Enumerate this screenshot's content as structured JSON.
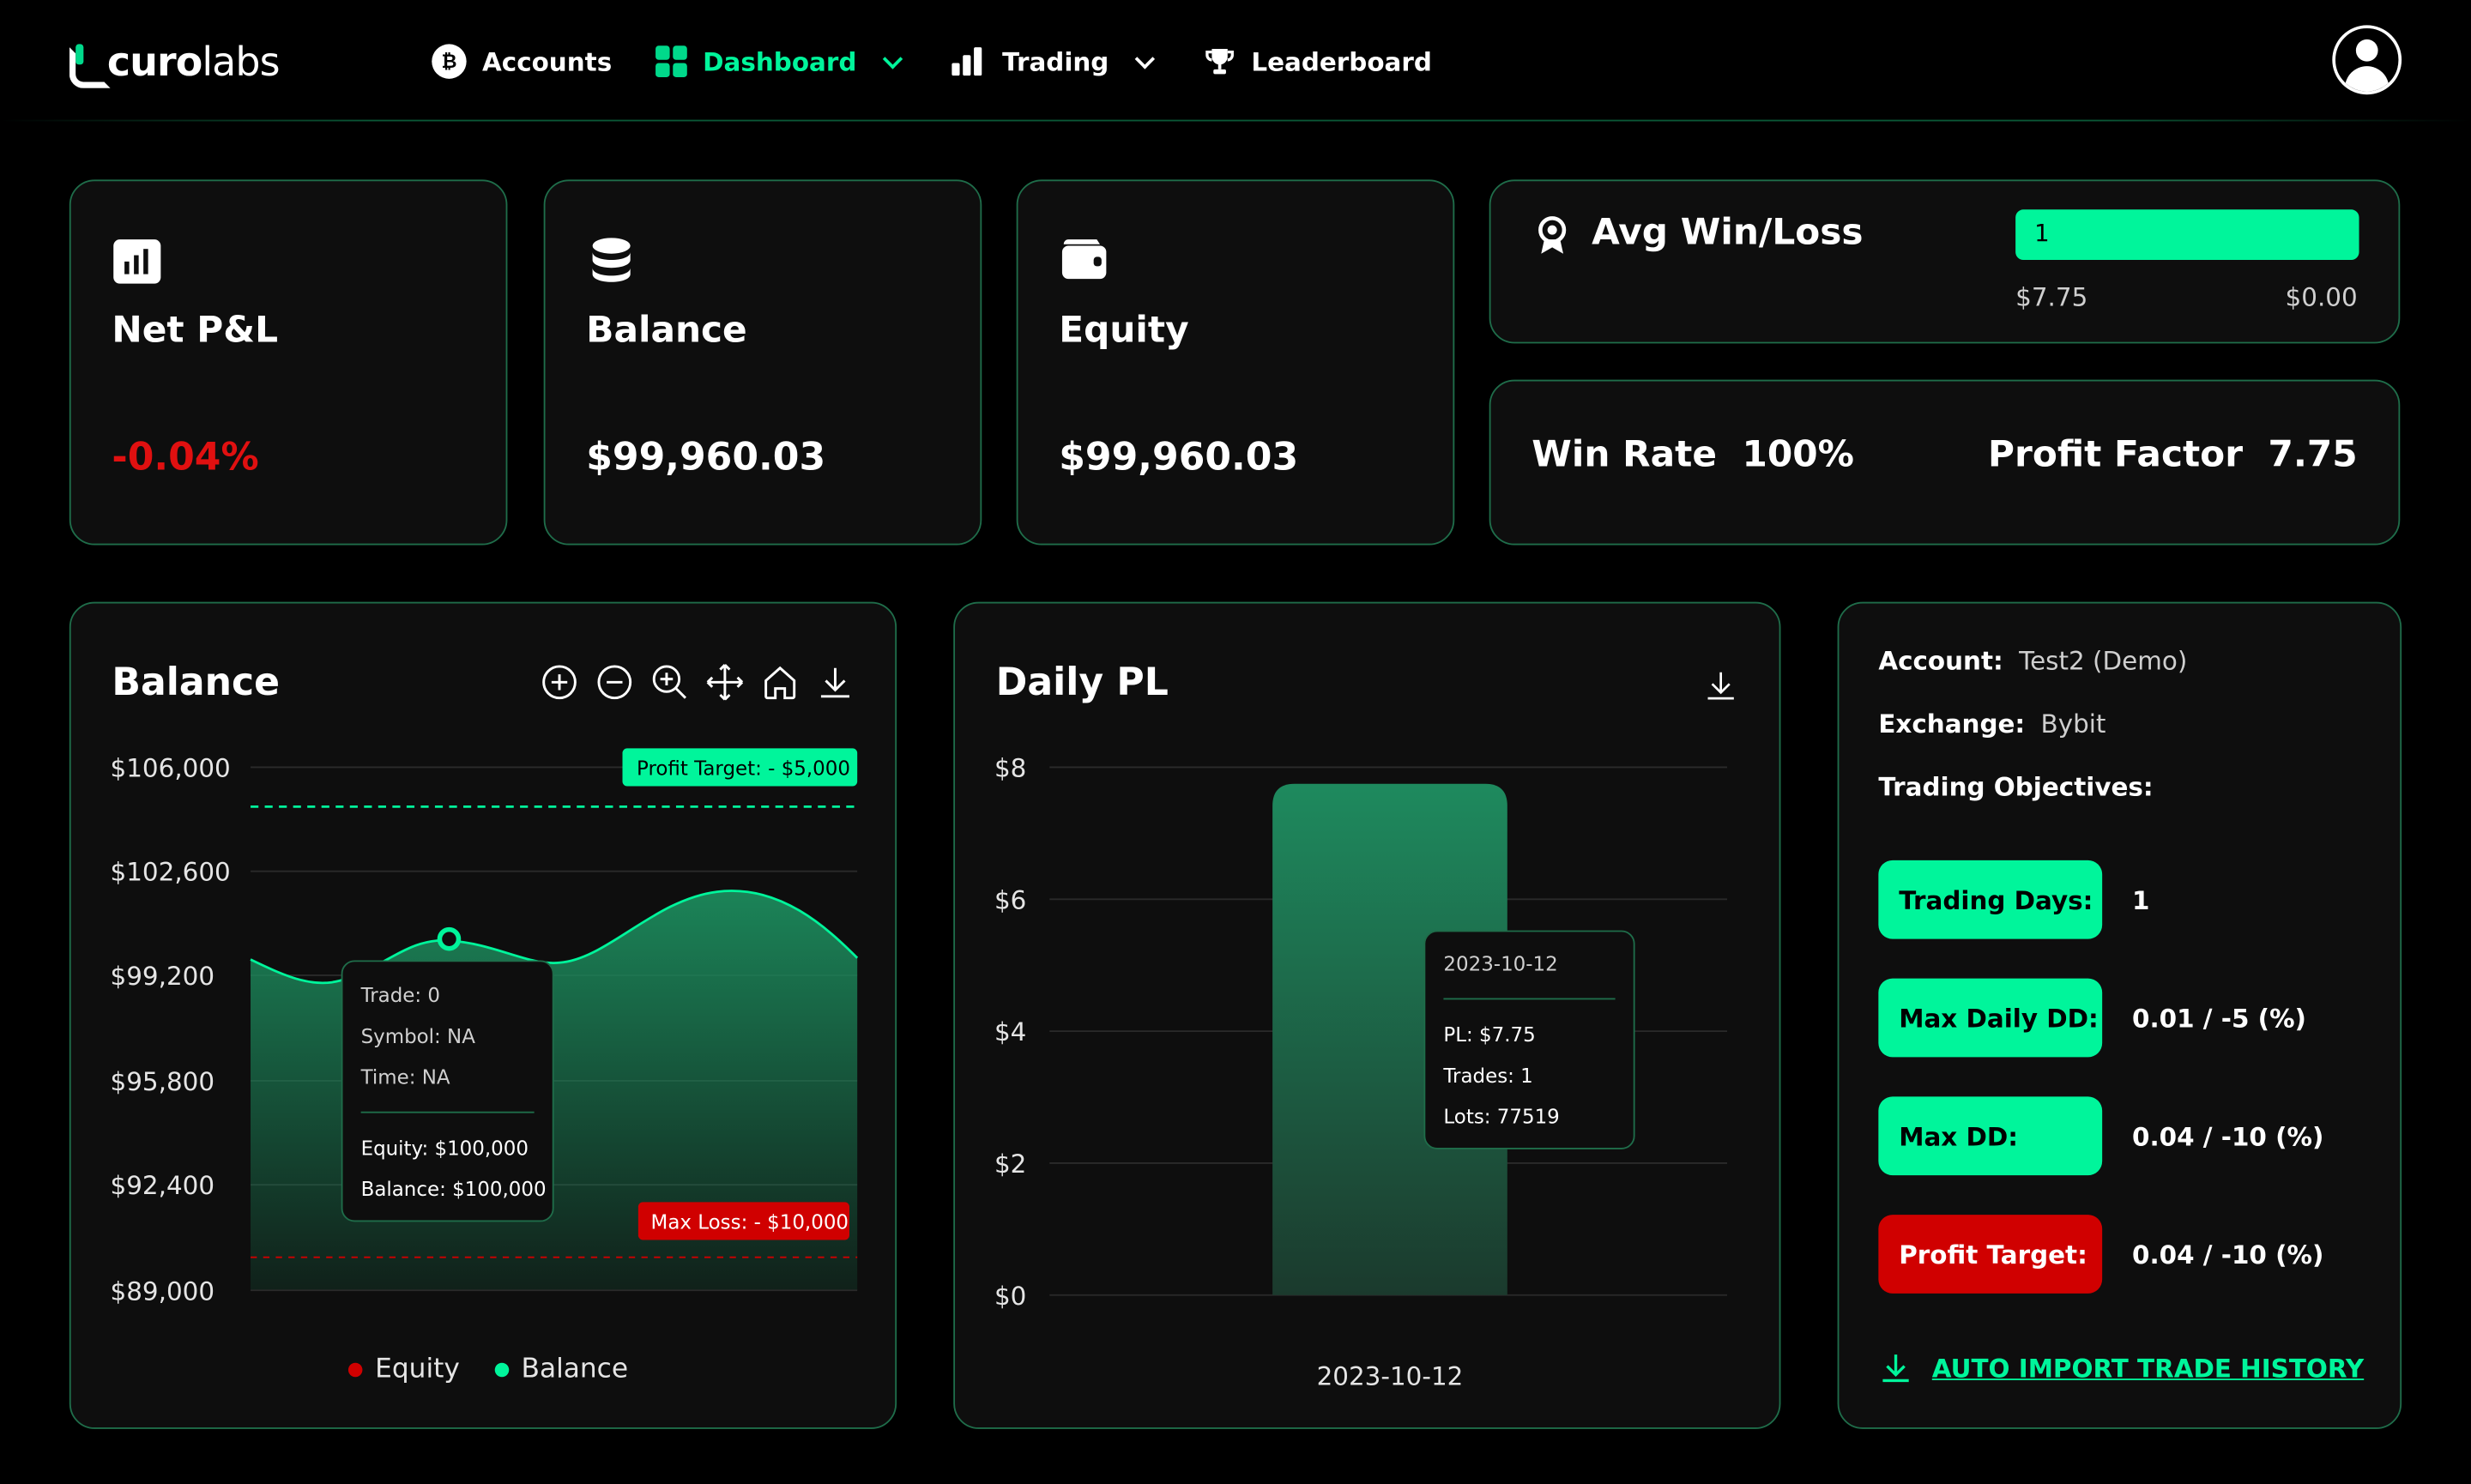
{
  "brand": {
    "part1": "curo",
    "part2": "labs"
  },
  "nav": [
    {
      "label": "Accounts"
    },
    {
      "label": "Dashboard"
    },
    {
      "label": "Trading"
    },
    {
      "label": "Leaderboard"
    }
  ],
  "stats": {
    "net_pl": {
      "label": "Net P&L",
      "value": "-0.04%"
    },
    "balance": {
      "label": "Balance",
      "value": "$99,960.03"
    },
    "equity": {
      "label": "Equity",
      "value": "$99,960.03"
    }
  },
  "avg_win_loss": {
    "label": "Avg Win/Loss",
    "bar_value": "1",
    "win": "$7.75",
    "loss": "$0.00"
  },
  "win_rate": {
    "label": "Win Rate",
    "value": "100%"
  },
  "profit_factor": {
    "label": "Profit Factor",
    "value": "7.75"
  },
  "balance_chart": {
    "title": "Balance",
    "y_ticks": [
      "$106,000",
      "$102,600",
      "$99,200",
      "$95,800",
      "$92,400",
      "$89,000"
    ],
    "profit_target_label": "Profit Target: - $5,000",
    "max_loss_label": "Max Loss: - $10,000",
    "tooltip": {
      "trade": "Trade: 0",
      "symbol": "Symbol: NA",
      "time": "Time: NA",
      "equity": "Equity: $100,000",
      "balance": "Balance: $100,000"
    },
    "legend": [
      {
        "name": "Equity",
        "color": "#d00000"
      },
      {
        "name": "Balance",
        "color": "#00f59b"
      }
    ]
  },
  "chart_data": {
    "type": "bar",
    "title": "Daily PL",
    "categories": [
      "2023-10-12"
    ],
    "values": [
      7.75
    ],
    "y_ticks": [
      "$8",
      "$6",
      "$4",
      "$2",
      "$0"
    ],
    "ylim": [
      0,
      8
    ],
    "tooltip": {
      "date": "2023-10-12",
      "pl": "PL: $7.75",
      "trades": "Trades: 1",
      "lots": "Lots: 77519"
    }
  },
  "account": {
    "account_label": "Account:",
    "account_value": "Test2 (Demo)",
    "exchange_label": "Exchange:",
    "exchange_value": "Bybit",
    "objectives_label": "Trading Objectives:",
    "objectives": [
      {
        "label": "Trading Days:",
        "value": "1"
      },
      {
        "label": "Max Daily DD:",
        "value": "0.01 / -5 (%)"
      },
      {
        "label": "Max DD:",
        "value": "0.04 / -10 (%)"
      },
      {
        "label": "Profit Target:",
        "value": "0.04 / -10 (%)"
      }
    ],
    "import_label": "AUTO IMPORT TRADE HISTORY"
  },
  "colors": {
    "accent": "#00f59b",
    "danger": "#d00000",
    "border": "#1f6d4a"
  }
}
